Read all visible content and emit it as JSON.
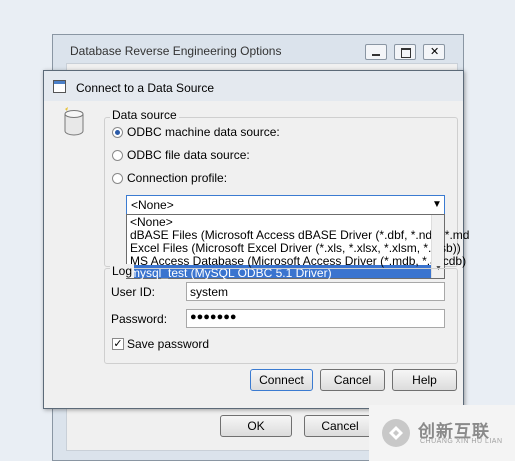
{
  "background_window": {
    "title": "Database Reverse Engineering Options",
    "ok_label": "OK",
    "cancel_label": "Cancel"
  },
  "dialog": {
    "title": "Connect to a Data Source",
    "data_source": {
      "legend": "Data source",
      "options": [
        {
          "label": "ODBC machine data source:",
          "selected": true
        },
        {
          "label": "ODBC file data source:",
          "selected": false
        },
        {
          "label": "Connection profile:",
          "selected": false
        }
      ],
      "combo_value": "<None>",
      "dropdown_items": [
        "<None>",
        "dBASE Files (Microsoft Access dBASE Driver (*.dbf, *.ndx, *.md",
        "Excel Files (Microsoft Excel Driver (*.xls, *.xlsx, *.xlsm, *.xlsb))",
        "MS Access Database (Microsoft Access Driver (*.mdb, *.accdb)",
        "mysql_test (MySQL ODBC 5.1 Driver)"
      ],
      "highlighted_item": "mysql_test (MySQL ODBC 5.1 Driver)"
    },
    "login": {
      "legend": "Log",
      "user_id_label": "User ID:",
      "user_id_value": "system",
      "password_label": "Password:",
      "password_value": "●●●●●●●",
      "save_password_label": "Save password",
      "save_password_checked": true
    },
    "buttons": {
      "connect": "Connect",
      "cancel": "Cancel",
      "help": "Help"
    }
  },
  "watermark": {
    "text": "创新互联",
    "subtext": "CHUANG XIN HU LIAN"
  },
  "colors": {
    "selection": "#3a74cf",
    "focus_border": "#3b7bd1"
  }
}
